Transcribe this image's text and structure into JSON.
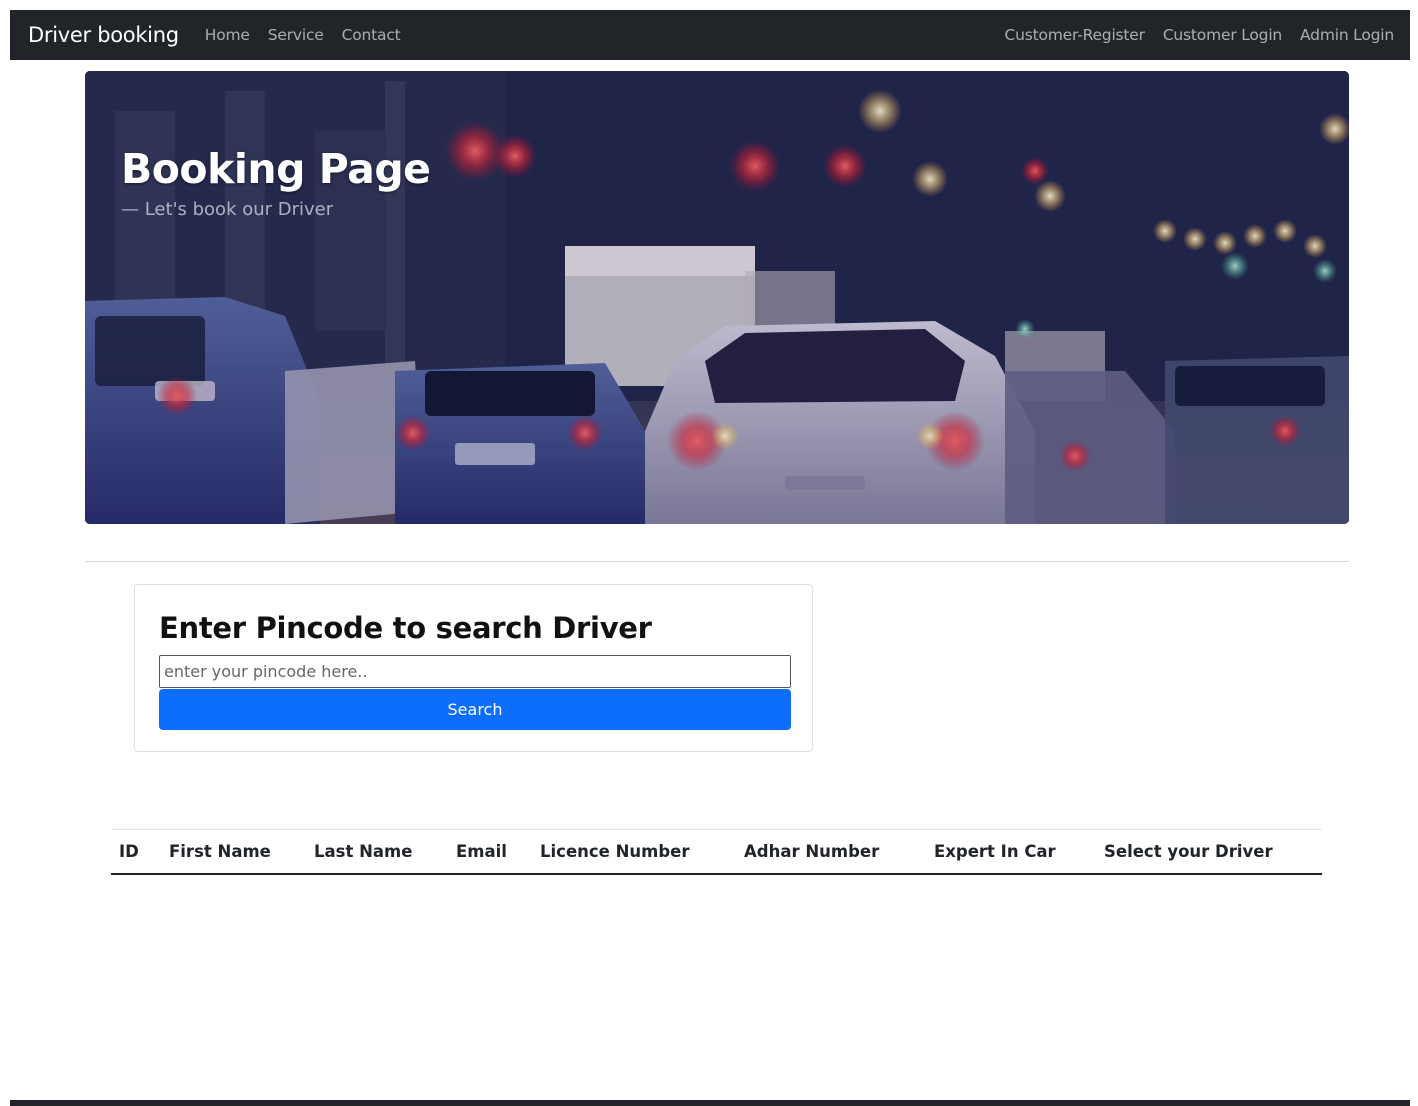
{
  "navbar": {
    "brand": "Driver booking",
    "left_links": [
      "Home",
      "Service",
      "Contact"
    ],
    "right_links": [
      "Customer-Register",
      "Customer Login",
      "Admin Login"
    ]
  },
  "hero": {
    "title": "Booking Page",
    "subtitle": "— Let's book our Driver"
  },
  "search": {
    "heading": "Enter Pincode to search Driver",
    "placeholder": "enter your pincode here..",
    "value": "",
    "button_label": "Search"
  },
  "table": {
    "headers": [
      "ID",
      "First Name",
      "Last Name",
      "Email",
      "Licence Number",
      "Adhar Number",
      "Expert In Car",
      "Select your Driver"
    ]
  },
  "colors": {
    "navbar_bg": "#212529",
    "primary": "#0d6efd"
  }
}
